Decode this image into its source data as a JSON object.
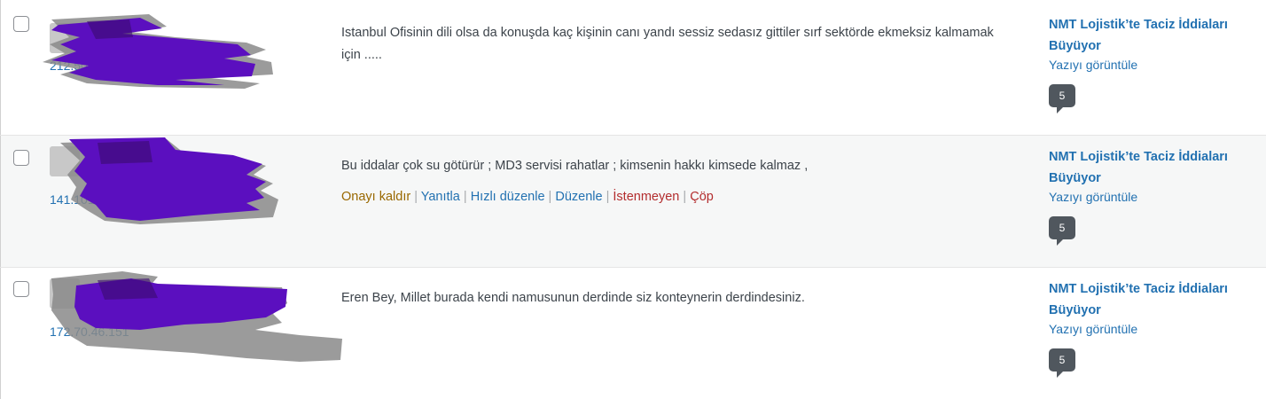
{
  "comments": [
    {
      "ip": "212.50.248.128",
      "text": "Istanbul Ofisinin dili olsa da konuşda kaç kişinin canı yandı sessiz sedasız gittiler sırf sektörde ekmeksiz kalmamak için .....",
      "response": {
        "title": "NMT Lojistik’te Taciz İddiaları Büyüyor",
        "view": "Yazıyı görüntüle",
        "count": "5"
      }
    },
    {
      "ip": "141.101.96.5",
      "text": "Bu iddalar çok su götürür ; MD3 servisi rahatlar ; kimsenin hakkı kimsede kalmaz ,",
      "actions": {
        "approve": "Onayı kaldır",
        "reply": "Yanıtla",
        "quick_edit": "Hızlı düzenle",
        "edit": "Düzenle",
        "spam": "İstenmeyen",
        "trash": "Çöp",
        "separator": "|"
      },
      "response": {
        "title": "NMT Lojistik’te Taciz İddiaları Büyüyor",
        "view": "Yazıyı görüntüle",
        "count": "5"
      }
    },
    {
      "ip": "172.70.46.151",
      "text": "Eren Bey, Millet burada kendi namusunun derdinde siz konteynerin derdindesiniz.",
      "response": {
        "title": "NMT Lojistik’te Taciz İddiaları Büyüyor",
        "view": "Yazıyı görüntüle",
        "count": "5"
      }
    }
  ],
  "colors": {
    "link": "#2271b1",
    "approve": "#996800",
    "delete": "#b32d2e",
    "redaction_purple": "#5b0fbf",
    "redaction_gray": "#8a8a8a",
    "bubble": "#50575e",
    "alt_row": "#f6f7f7"
  }
}
